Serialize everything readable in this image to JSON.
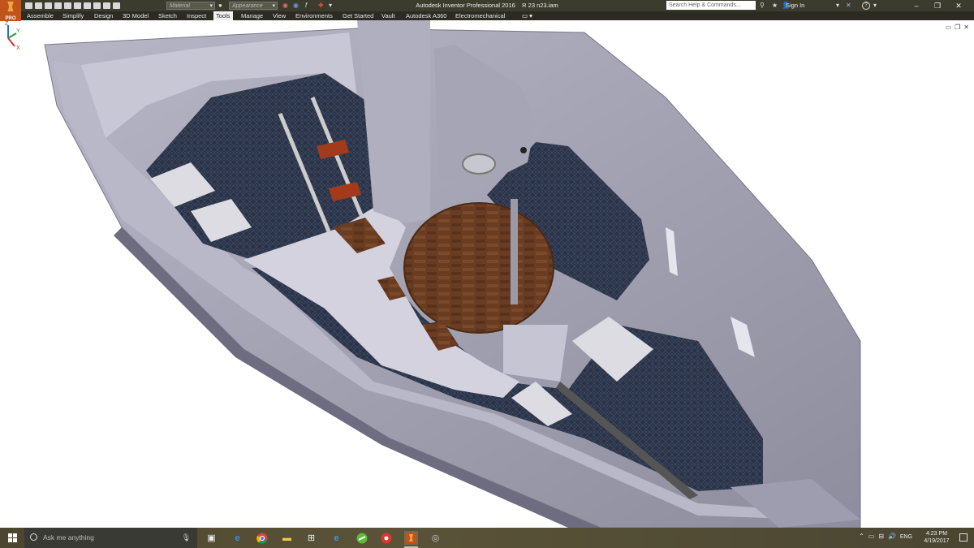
{
  "app": {
    "logo_label": "PRO",
    "window_title": "Autodesk Inventor Professional 2016",
    "file_name": "R 23 n23.iam"
  },
  "quick_access": {
    "material_placeholder": "Material",
    "appearance_placeholder": "Appearance"
  },
  "header": {
    "search_placeholder": "Search Help & Commands...",
    "sign_in_label": "Sign In",
    "help_label": "?"
  },
  "ribbon": {
    "tabs": [
      {
        "label": "Assemble"
      },
      {
        "label": "Simplify"
      },
      {
        "label": "Design"
      },
      {
        "label": "3D Model"
      },
      {
        "label": "Sketch"
      },
      {
        "label": "Inspect"
      },
      {
        "label": "Tools",
        "active": true
      },
      {
        "label": "Manage"
      },
      {
        "label": "View"
      },
      {
        "label": "Environments"
      },
      {
        "label": "Get Started"
      },
      {
        "label": "Vault"
      },
      {
        "label": "Autodesk A360"
      },
      {
        "label": "Electromechanical"
      }
    ]
  },
  "viewcube": {
    "axis_x": "X",
    "axis_y": "Y",
    "axis_z": "Z"
  },
  "taskbar": {
    "search_placeholder": "Ask me anything",
    "apps": [
      {
        "icon": "task-view-icon"
      },
      {
        "icon": "edge-icon"
      },
      {
        "icon": "chrome-icon"
      },
      {
        "icon": "file-explorer-icon"
      },
      {
        "icon": "store-icon"
      },
      {
        "icon": "ie-icon"
      },
      {
        "icon": "green-app-icon"
      },
      {
        "icon": "red-app-icon"
      },
      {
        "icon": "inventor-icon",
        "active": true
      },
      {
        "icon": "grey-app-icon"
      }
    ],
    "language": "ENG",
    "time": "4:23 PM",
    "date": "4/19/2017"
  },
  "colors": {
    "title_bar": "#3c3c2e",
    "ribbon_bar": "#2b2b23",
    "hull": "#a9a8b8",
    "deck_light": "#c9c8d6",
    "carpet": "#2a3244",
    "wood": "#6a3d22",
    "step_red": "#a33a1c",
    "taskbar": "#544e36"
  }
}
